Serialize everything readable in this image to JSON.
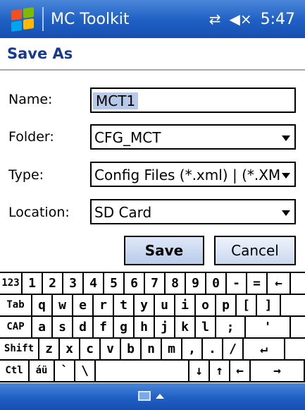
{
  "titlebar": {
    "app_title": "MC Toolkit",
    "clock": "5:47",
    "connectivity_symbol": "⇄",
    "volume_symbol": "◀×"
  },
  "heading": "Save As",
  "form": {
    "name_label": "Name:",
    "name_value": "MCT1",
    "folder_label": "Folder:",
    "folder_value": "CFG_MCT",
    "type_label": "Type:",
    "type_value": "Config Files (*.xml) | (*.XM",
    "location_label": "Location:",
    "location_value": "SD Card"
  },
  "buttons": {
    "save": "Save",
    "cancel": "Cancel"
  },
  "keyboard": {
    "rows": [
      [
        "123",
        "1",
        "2",
        "3",
        "4",
        "5",
        "6",
        "7",
        "8",
        "9",
        "0",
        "-",
        "=",
        "←"
      ],
      [
        "Tab",
        "q",
        "w",
        "e",
        "r",
        "t",
        "y",
        "u",
        "i",
        "o",
        "p",
        "[",
        "]"
      ],
      [
        "CAP",
        "a",
        "s",
        "d",
        "f",
        "g",
        "h",
        "j",
        "k",
        "l",
        ";",
        "'"
      ],
      [
        "Shift",
        "z",
        "x",
        "c",
        "v",
        "b",
        "n",
        "m",
        ",",
        ".",
        "/",
        "↵"
      ],
      [
        "Ctl",
        "áü",
        "`",
        "\\",
        "",
        "↓",
        "↑",
        "←",
        "→"
      ]
    ]
  },
  "colors": {
    "titlebar": "#1f5fc4",
    "heading_text": "#163a8e",
    "selection": "#b7c9e8"
  }
}
